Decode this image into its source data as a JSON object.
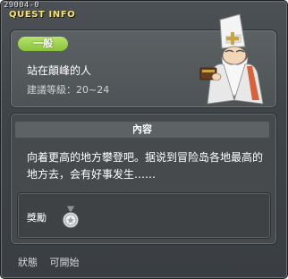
{
  "window": {
    "id_code": "29004-0",
    "title": "QUEST INFO"
  },
  "quest": {
    "category": "一般",
    "name": "站在顛峰的人",
    "level": "建議等級：20~24",
    "npc_icon": "old-sage-npc-icon"
  },
  "content": {
    "header": "內容",
    "description": "向着更高的地方攀登吧。据说到冒险岛各地最高的地方去，会有好事发生……"
  },
  "reward": {
    "label": "獎勵",
    "icon": "medal-icon"
  },
  "status": {
    "label": "狀態",
    "value": "可開始"
  },
  "colors": {
    "title_yellow": "#f7e26b",
    "badge_green": "#9ed24f",
    "window_bg": "#43484c"
  }
}
